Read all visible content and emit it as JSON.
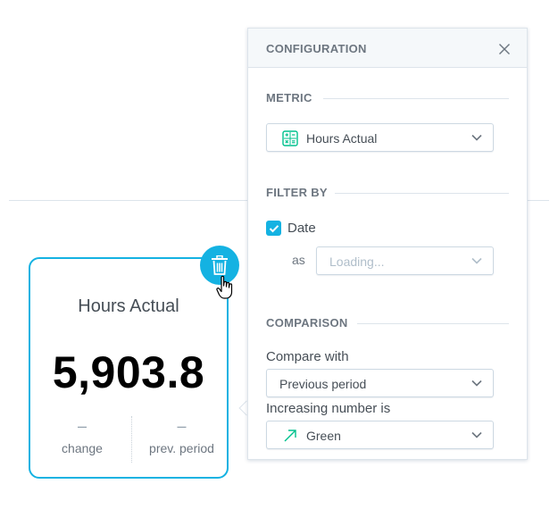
{
  "kpi": {
    "title": "Hours Actual",
    "value": "5,903.8",
    "change_value": "–",
    "change_label": "change",
    "prev_value": "–",
    "prev_label": "prev. period"
  },
  "config": {
    "title": "CONFIGURATION",
    "metric_heading": "METRIC",
    "metric_selected": "Hours Actual",
    "filter_heading": "FILTER BY",
    "filter_date_label": "Date",
    "filter_date_checked": true,
    "as_label": "as",
    "as_placeholder": "Loading...",
    "comparison_heading": "COMPARISON",
    "compare_with_label": "Compare with",
    "compare_with_value": "Previous period",
    "increasing_label": "Increasing number is",
    "increasing_value": "Green"
  },
  "colors": {
    "accent": "#14b2e2",
    "positive": "#00c18d"
  },
  "icons": {
    "delete": "trash-icon",
    "close": "close-icon",
    "metric": "calculator-icon",
    "trend": "arrow-up-right-icon",
    "dropdown": "chevron-down-icon",
    "cursor": "hand-pointer-icon"
  }
}
